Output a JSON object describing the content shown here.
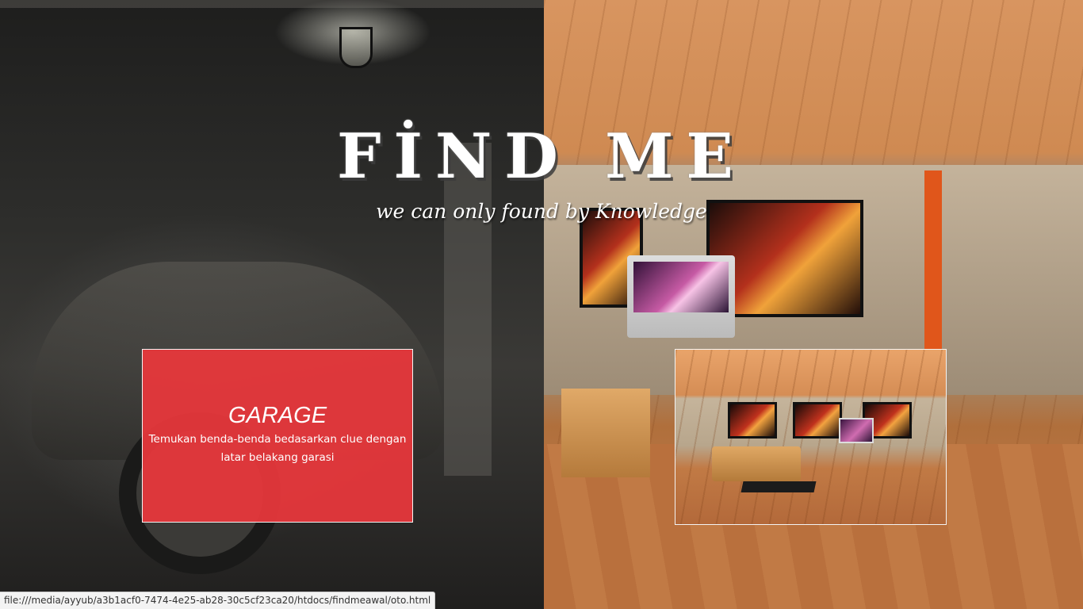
{
  "header": {
    "title": "FİND ME",
    "tagline": "we can only found by Knowledge"
  },
  "cards": [
    {
      "title": "GARAGE",
      "description": "Temukan benda-benda bedasarkan clue dengan latar belakang garasi"
    }
  ],
  "status_bar": {
    "url": "file:///media/ayyub/a3b1acf0-7474-4e25-ab28-30c5cf23ca20/htdocs/findmeawal/oto.html"
  },
  "colors": {
    "garage_card": "#e8373c",
    "text": "#ffffff"
  }
}
